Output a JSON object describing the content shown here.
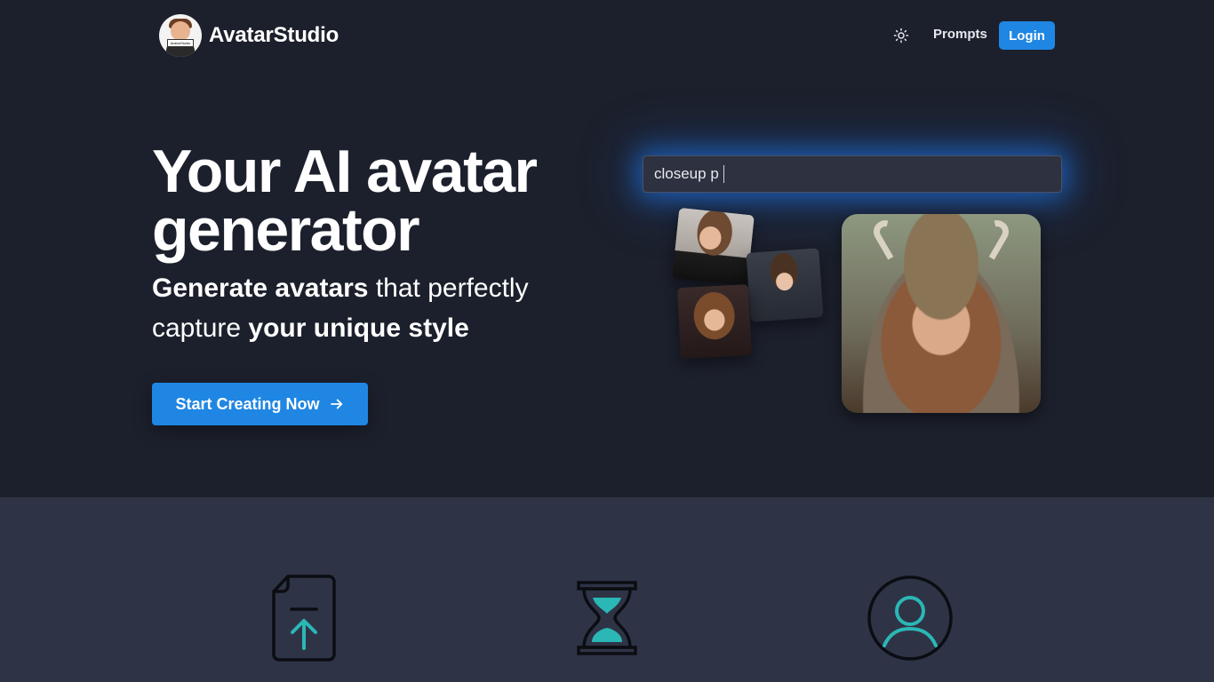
{
  "header": {
    "brand_name": "AvatarStudio",
    "logo_sign_text": "AvatarStudio",
    "nav_prompts": "Prompts",
    "nav_login": "Login",
    "theme_icon": "sun-icon"
  },
  "hero": {
    "title": "Your AI avatar generator",
    "subtitle_bold_1": "Generate avatars",
    "subtitle_normal_1": " that perfectly capture ",
    "subtitle_bold_2": "your unique style",
    "cta_label": "Start Creating Now",
    "cta_icon": "arrow-right-icon",
    "prompt_text": "closeup p"
  },
  "features": {
    "icons": [
      "file-upload-icon",
      "hourglass-icon",
      "user-icon"
    ]
  },
  "colors": {
    "accent": "#1f86e3",
    "background": "#1c202c",
    "features_background": "#2e3446",
    "icon_teal": "#2bb7b5"
  }
}
